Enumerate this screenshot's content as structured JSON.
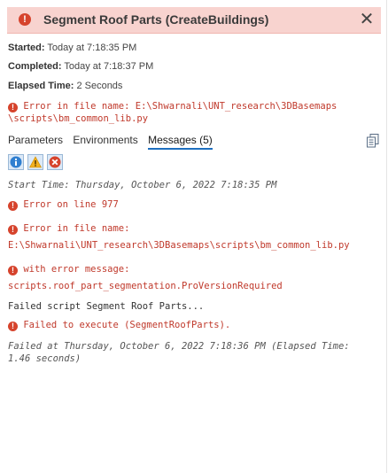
{
  "header": {
    "title": "Segment Roof Parts (CreateBuildings)",
    "status_icon": "error-icon",
    "close_icon": "close-icon",
    "background": "#f8d3cf"
  },
  "meta": {
    "started_label": "Started:",
    "started_value": " Today at 7:18:35 PM",
    "completed_label": "Completed:",
    "completed_value": " Today at 7:18:37 PM",
    "elapsed_label": "Elapsed Time:",
    "elapsed_value": " 2 Seconds"
  },
  "error_summary": {
    "line1": "Error in file name:  E:\\Shwarnali\\UNT_research\\3DBasemaps",
    "line2": "\\scripts\\bm_common_lib.py"
  },
  "tabs": [
    {
      "label": "Parameters",
      "active": false
    },
    {
      "label": "Environments",
      "active": false
    },
    {
      "label": "Messages (5)",
      "active": true
    }
  ],
  "filters": [
    {
      "icon": "info-icon",
      "selected": true
    },
    {
      "icon": "warning-icon",
      "selected": true
    },
    {
      "icon": "error-icon",
      "selected": true
    }
  ],
  "messages": [
    {
      "type": "info",
      "text": "Start Time: Thursday, October 6, 2022 7:18:35 PM"
    },
    {
      "type": "error",
      "text": "Error on line 977"
    },
    {
      "type": "error",
      "text": "Error in file name:",
      "detail": "E:\\Shwarnali\\UNT_research\\3DBasemaps\\scripts\\bm_common_lib.py"
    },
    {
      "type": "error",
      "text": "with error message:",
      "detail": "scripts.roof_part_segmentation.ProVersionRequired"
    },
    {
      "type": "plain",
      "text": "Failed script Segment Roof Parts..."
    },
    {
      "type": "error",
      "text": "Failed to execute (SegmentRoofParts)."
    },
    {
      "type": "info",
      "text": "Failed at Thursday, October 6, 2022 7:18:36 PM (Elapsed Time:",
      "detail": "1.46 seconds)"
    }
  ],
  "colors": {
    "error": "#c0392b",
    "accent": "#1e6fbf"
  }
}
